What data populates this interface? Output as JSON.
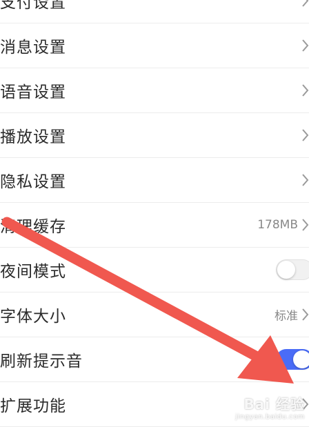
{
  "settings": {
    "items": [
      {
        "label": "支付设置"
      },
      {
        "label": "消息设置"
      },
      {
        "label": "语音设置"
      },
      {
        "label": "播放设置"
      },
      {
        "label": "隐私设置"
      },
      {
        "label": "清理缓存",
        "value": "178MB"
      },
      {
        "label": "夜间模式",
        "toggle_on": false
      },
      {
        "label": "字体大小",
        "value": "标准"
      },
      {
        "label": "刷新提示音",
        "toggle_on": true
      },
      {
        "label": "扩展功能"
      }
    ]
  },
  "colors": {
    "toggle_on": "#4a6cf7",
    "annotation_arrow": "#f0584f"
  },
  "watermark": {
    "main": "Bai 经验",
    "sub": "jingyan.baidu.com"
  }
}
